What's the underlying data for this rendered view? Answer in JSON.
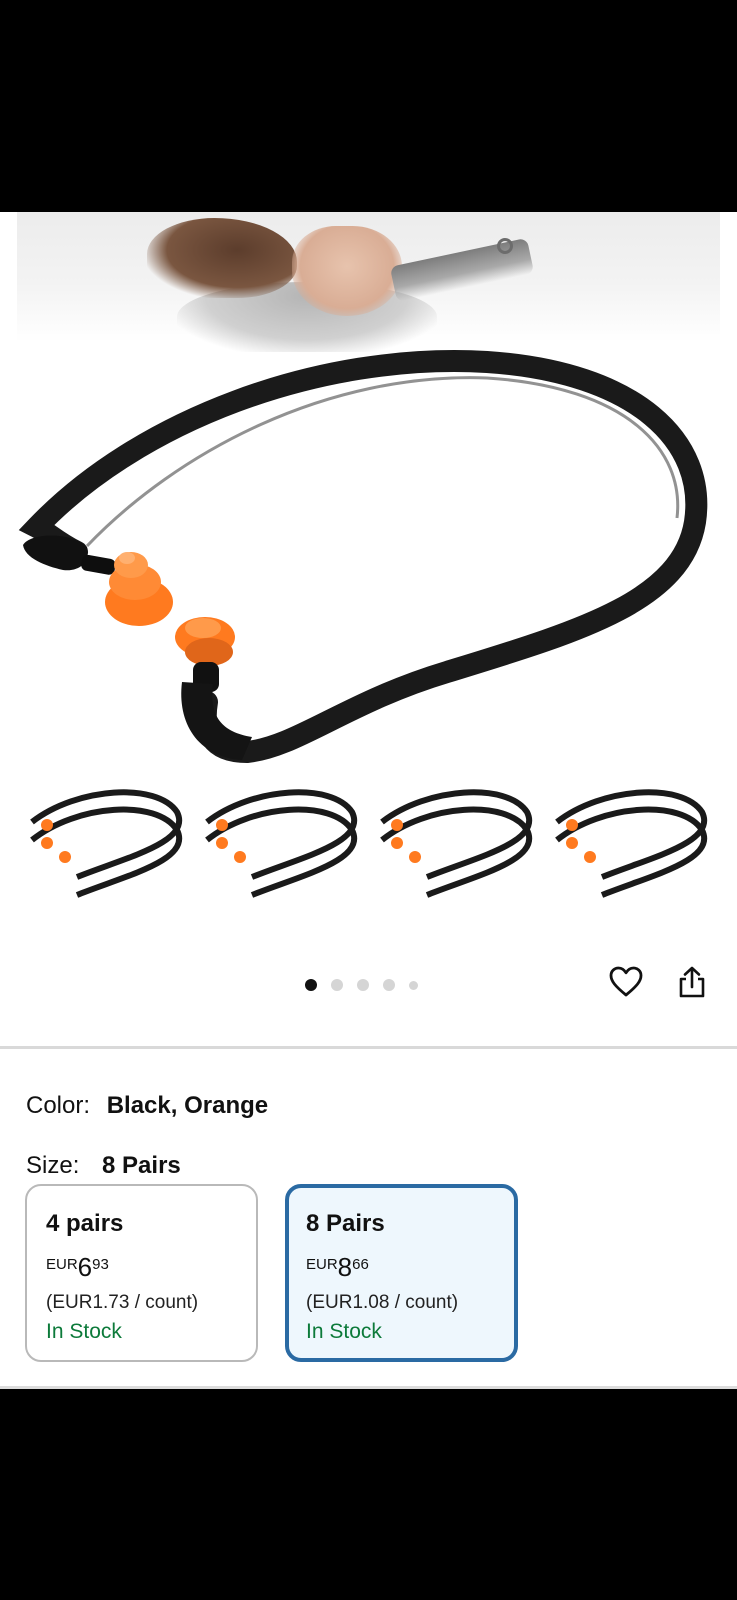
{
  "gallery": {
    "image_count": 5,
    "active_index": 0,
    "colors": {
      "band": "#1a1a1a",
      "plug": "#ff7a1f",
      "dot_active": "#111111",
      "dot_inactive": "#d5d5d5"
    }
  },
  "actions": {
    "favorite_icon": "heart-icon",
    "share_icon": "share-icon"
  },
  "color": {
    "label": "Color:",
    "value": "Black, Orange"
  },
  "size": {
    "label": "Size:",
    "value": "8 Pairs"
  },
  "options": [
    {
      "name": "4 pairs",
      "currency": "EUR",
      "whole": "6",
      "fraction": "93",
      "unit_price": "(EUR1.73 / count)",
      "stock": "In Stock",
      "selected": false
    },
    {
      "name": "8 Pairs",
      "currency": "EUR",
      "whole": "8",
      "fraction": "66",
      "unit_price": "(EUR1.08 / count)",
      "stock": "In Stock",
      "selected": true
    }
  ],
  "theme": {
    "selected_border": "#2a6aa3",
    "selected_bg": "#eef7fd",
    "stock_green": "#0c7a3a"
  }
}
